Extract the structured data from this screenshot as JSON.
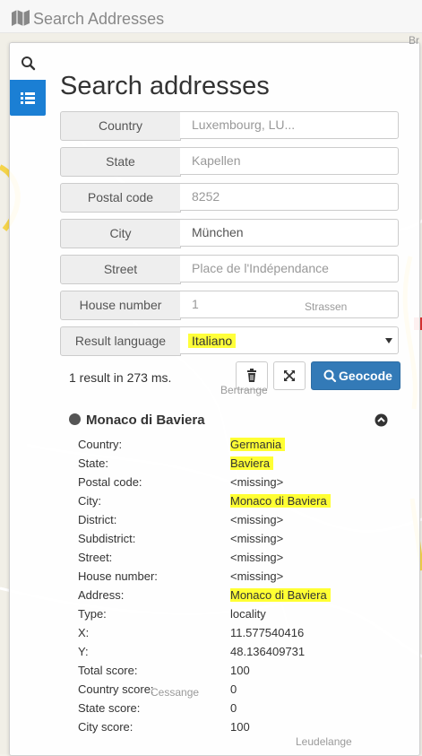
{
  "header": {
    "title": "Search Addresses",
    "icon": "map-icon"
  },
  "map": {
    "labels": [
      "Br",
      "Strassen",
      "Bertrange",
      "Leudelange",
      "Cessange"
    ]
  },
  "panel": {
    "title": "Search addresses",
    "tabs": [
      {
        "name": "search-tab",
        "icon": "search-icon"
      },
      {
        "name": "results-tab",
        "icon": "list-icon",
        "active": true
      }
    ],
    "form": {
      "country": {
        "label": "Country",
        "placeholder": "Luxembourg, LU..."
      },
      "state": {
        "label": "State",
        "placeholder": "Kapellen"
      },
      "postal_code": {
        "label": "Postal code",
        "placeholder": "8252"
      },
      "city": {
        "label": "City",
        "value": "München"
      },
      "street": {
        "label": "Street",
        "placeholder": "Place de l'Indépendance"
      },
      "house_number": {
        "label": "House number",
        "placeholder": "1"
      },
      "result_language": {
        "label": "Result language",
        "value": "Italiano"
      }
    },
    "result_info": "1 result in 273 ms.",
    "buttons": {
      "clear_icon": "trash-icon",
      "zoom_icon": "expand-icon",
      "geocode_label": "Geocode"
    },
    "result": {
      "title": "Monaco di Baviera",
      "properties": [
        {
          "label": "Country:",
          "value": "Germania",
          "highlight": true
        },
        {
          "label": "State:",
          "value": "Baviera",
          "highlight": true
        },
        {
          "label": "Postal code:",
          "value": "<missing>"
        },
        {
          "label": "City:",
          "value": "Monaco di Baviera",
          "highlight": true
        },
        {
          "label": "District:",
          "value": "<missing>"
        },
        {
          "label": "Subdistrict:",
          "value": "<missing>"
        },
        {
          "label": "Street:",
          "value": "<missing>"
        },
        {
          "label": "House number:",
          "value": "<missing>"
        },
        {
          "label": "Address:",
          "value": "Monaco di Baviera",
          "highlight": true
        },
        {
          "label": "Type:",
          "value": "locality"
        },
        {
          "label": "X:",
          "value": "11.577540416"
        },
        {
          "label": "Y:",
          "value": "48.136409731"
        },
        {
          "label": "Total score:",
          "value": "100"
        },
        {
          "label": "Country score:",
          "value": "0"
        },
        {
          "label": "State score:",
          "value": "0"
        },
        {
          "label": "City score:",
          "value": "100"
        }
      ]
    }
  },
  "colors": {
    "accent": "#1b7fd4",
    "primary_button": "#337ab7",
    "highlight": "#ffff33"
  }
}
